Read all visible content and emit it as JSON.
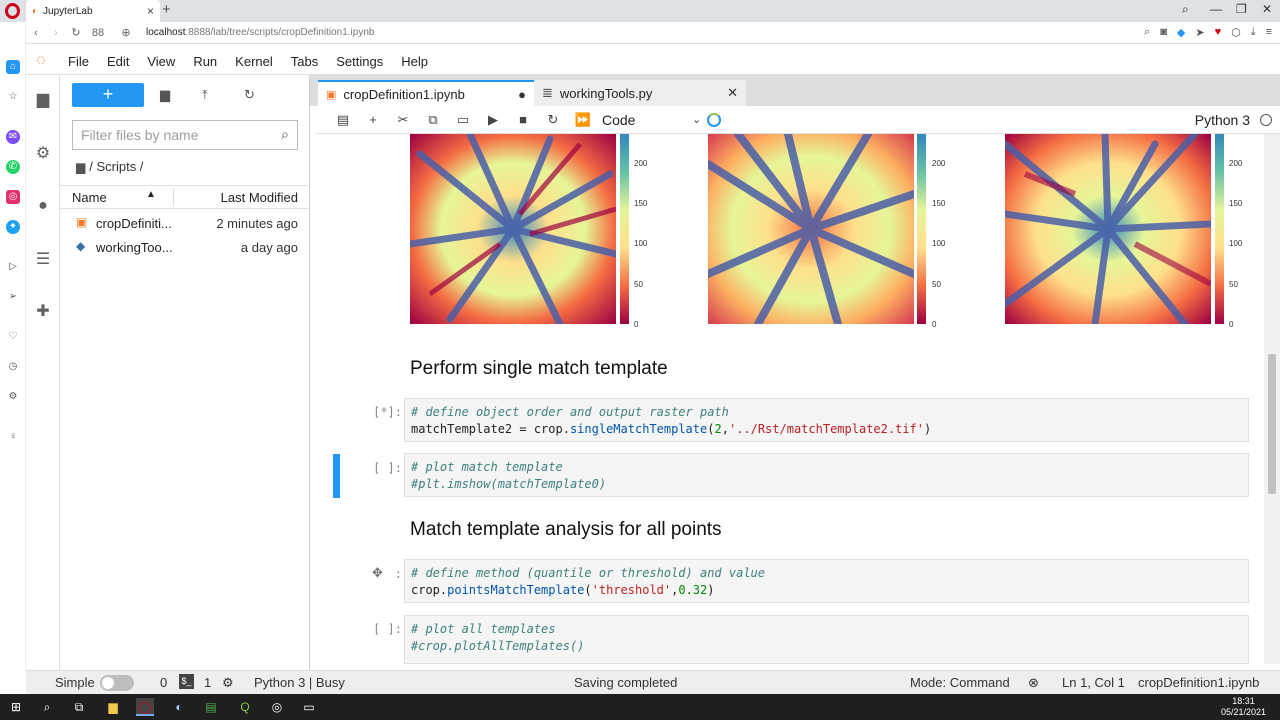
{
  "browser": {
    "tab_title": "JupyterLab",
    "tab_close": "×",
    "new_tab": "+",
    "url_host": "localhost",
    "url_rest": ":8888/lab/tree/scripts/cropDefinition1.ipynb",
    "speed_dial_count": "88"
  },
  "menu": [
    "File",
    "Edit",
    "View",
    "Run",
    "Kernel",
    "Tabs",
    "Settings",
    "Help"
  ],
  "filebrowser": {
    "new_label": "+",
    "filter_placeholder": "Filter files by name",
    "breadcrumb": "/ Scripts /",
    "col_name": "Name",
    "col_modified": "Last Modified",
    "files": [
      {
        "name": "cropDefiniti...",
        "modified": "2 minutes ago"
      },
      {
        "name": "workingToo...",
        "modified": "a day ago"
      }
    ]
  },
  "notebook_tabs": [
    {
      "label": "cropDefinition1.ipynb",
      "marker": "●"
    },
    {
      "label": "workingTools.py",
      "marker": "✕"
    }
  ],
  "toolbar": {
    "cell_type": "Code",
    "kernel_name": "Python 3"
  },
  "colorbar_ticks": [
    "200",
    "150",
    "100",
    "50",
    "0"
  ],
  "cells": {
    "heading1": "Perform single match template",
    "cell1_prompt": "[*]:",
    "cell1_line1": "# define object order and output raster path",
    "cell1_line2_a": "matchTemplate2 = crop.",
    "cell1_line2_fn": "singleMatchTemplate",
    "cell1_line2_b": "(",
    "cell1_line2_num": "2",
    "cell1_line2_c": ",",
    "cell1_line2_str": "'../Rst/matchTemplate2.tif'",
    "cell1_line2_d": ")",
    "cell2_prompt": "[ ]:",
    "cell2_line1": "# plot match template",
    "cell2_line2": "#plt.imshow(matchTemplate0)",
    "heading2": "Match template analysis for all points",
    "cell3_prompt": ":",
    "cell3_line1": "# define method (quantile or threshold) and value",
    "cell3_line2_a": "crop.",
    "cell3_line2_fn": "pointsMatchTemplate",
    "cell3_line2_b": "(",
    "cell3_line2_str": "'threshold'",
    "cell3_line2_c": ",",
    "cell3_line2_num": "0.32",
    "cell3_line2_d": ")",
    "cell4_prompt": "[ ]:",
    "cell4_line1": "# plot all templates",
    "cell4_line2": "#crop.plotAllTemplates()"
  },
  "statusbar": {
    "mode_simple": "Simple",
    "count_a": "0",
    "count_b": "1",
    "kernel_status": "Python 3 | Busy",
    "save_status": "Saving completed",
    "mode": "Mode: Command",
    "position": "Ln 1, Col 1",
    "filename": "cropDefinition1.ipynb"
  },
  "taskbar": {
    "time": "18:31",
    "date": "05/21/2021"
  },
  "colors": {
    "accent": "#2196f3",
    "jupyter_orange": "#f37726",
    "opera_red": "#d0021b"
  }
}
